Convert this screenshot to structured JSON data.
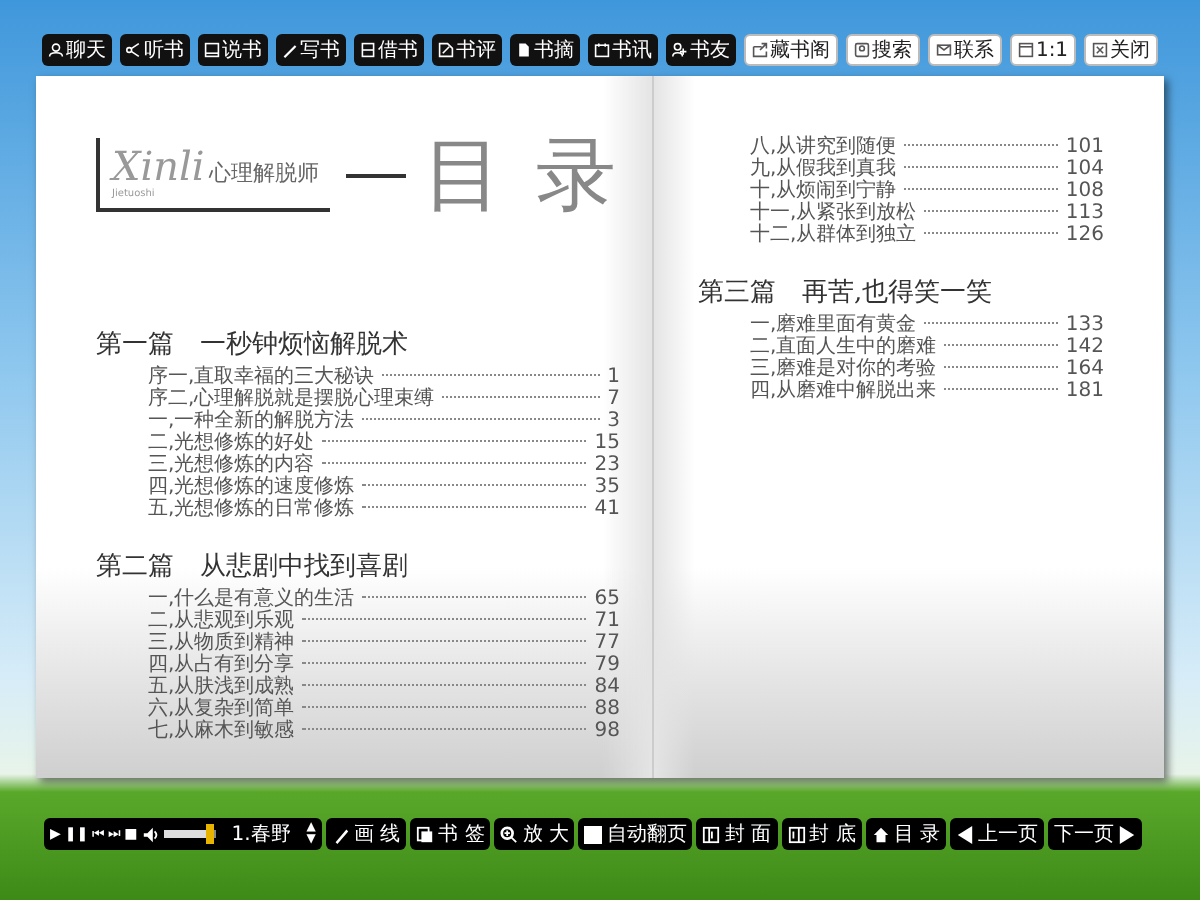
{
  "top_toolbar": {
    "dark_buttons": [
      {
        "label": "聊天"
      },
      {
        "label": "听书"
      },
      {
        "label": "说书"
      },
      {
        "label": "写书"
      },
      {
        "label": "借书"
      },
      {
        "label": "书评"
      },
      {
        "label": "书摘"
      },
      {
        "label": "书讯"
      },
      {
        "label": "书友"
      }
    ],
    "light_buttons": [
      {
        "label": "藏书阁"
      },
      {
        "label": "搜索"
      },
      {
        "label": "联系"
      },
      {
        "label": "1:1"
      },
      {
        "label": "关闭"
      }
    ]
  },
  "book": {
    "logo": {
      "latin": "Xinli",
      "subtitle": "Jietuoshi",
      "title": "心理解脱师"
    },
    "heading": "目 录",
    "left_page": [
      {
        "title": "第一篇　一秒钟烦恼解脱术",
        "entries": [
          {
            "text": "序一,直取幸福的三大秘诀",
            "page": "1"
          },
          {
            "text": "序二,心理解脱就是摆脱心理束缚",
            "page": "7"
          },
          {
            "text": "一,一种全新的解脱方法",
            "page": "3"
          },
          {
            "text": "二,光想修炼的好处",
            "page": "15"
          },
          {
            "text": "三,光想修炼的内容",
            "page": "23"
          },
          {
            "text": "四,光想修炼的速度修炼",
            "page": "35"
          },
          {
            "text": "五,光想修炼的日常修炼",
            "page": "41"
          }
        ]
      },
      {
        "title": "第二篇　从悲剧中找到喜剧",
        "entries": [
          {
            "text": "一,什么是有意义的生活",
            "page": "65"
          },
          {
            "text": "二,从悲观到乐观",
            "page": "71"
          },
          {
            "text": "三,从物质到精神",
            "page": "77"
          },
          {
            "text": "四,从占有到分享",
            "page": "79"
          },
          {
            "text": "五,从肤浅到成熟",
            "page": "84"
          },
          {
            "text": "六,从复杂到简单",
            "page": "88"
          },
          {
            "text": "七,从麻木到敏感",
            "page": "98"
          }
        ]
      }
    ],
    "right_page": [
      {
        "entries": [
          {
            "text": "八,从讲究到随便",
            "page": "101"
          },
          {
            "text": "九,从假我到真我",
            "page": "104"
          },
          {
            "text": "十,从烦闹到宁静",
            "page": "108"
          },
          {
            "text": "十一,从紧张到放松",
            "page": "113"
          },
          {
            "text": "十二,从群体到独立",
            "page": "126"
          }
        ]
      },
      {
        "title": "第三篇　再苦,也得笑一笑",
        "entries": [
          {
            "text": "一,磨难里面有黄金",
            "page": "133"
          },
          {
            "text": "二,直面人生中的磨难",
            "page": "142"
          },
          {
            "text": "三,磨难是对你的考验",
            "page": "164"
          },
          {
            "text": "四,从磨难中解脱出来",
            "page": "181"
          }
        ]
      }
    ]
  },
  "player": {
    "controls": [
      "▶",
      "❚❚",
      "⏮",
      "⏭",
      "■"
    ],
    "volume": {
      "level": 0.9
    },
    "track": "1.春野",
    "arrows": [
      "▲",
      "▼"
    ]
  },
  "bottom_toolbar": [
    {
      "label": "画 线"
    },
    {
      "label": "书 签"
    },
    {
      "label": "放 大"
    },
    {
      "label": "自动翻页"
    },
    {
      "label": "封 面"
    },
    {
      "label": "封 底"
    },
    {
      "label": "目 录"
    },
    {
      "label": "上一页",
      "kind": "prev"
    },
    {
      "label": "下一页",
      "kind": "next"
    }
  ]
}
